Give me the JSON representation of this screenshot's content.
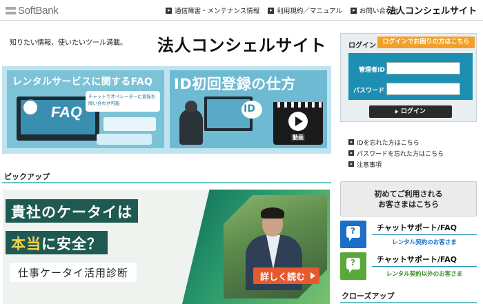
{
  "header": {
    "logo_text": "SoftBank",
    "links": [
      {
        "label": "通信障害・メンテナンス情報"
      },
      {
        "label": "利用規約／マニュアル"
      },
      {
        "label": "お問い合わせ"
      }
    ],
    "site_name": "法人コンシェルサイト"
  },
  "intro": {
    "tagline": "知りたい情報、使いたいツール満載。",
    "title": "法人コンシェルサイト"
  },
  "banners": {
    "faq": {
      "title": "レンタルサービスに関するFAQ",
      "bubble_text": "チャットでオペレーターに直接お問い合わせ可能",
      "screen_word": "FAQ"
    },
    "id": {
      "title": "ID初回登録の仕方",
      "bubble_text": "ID",
      "video_label": "動画"
    }
  },
  "pickup": {
    "section_label": "ピックアップ",
    "banner": {
      "line1": "貴社のケータイは",
      "line2_highlight": "本当",
      "line2_rest": "に安全？",
      "line3": "仕事ケータイ活用診断",
      "cta": "詳しく読む"
    }
  },
  "login": {
    "label": "ログイン",
    "help_button": "ログインでお困りの方はこちら",
    "admin_id_label": "管理者ID",
    "password_label": "パスワード",
    "admin_id_value": "",
    "password_value": "",
    "submit": "ログイン"
  },
  "side_links": [
    {
      "label": "IDを忘れた方はこちら"
    },
    {
      "label": "パスワードを忘れた方はこちら"
    },
    {
      "label": "注意事項"
    }
  ],
  "first_time": {
    "line1": "初めてご利用される",
    "line2": "お客さまはこちら"
  },
  "chat_support": [
    {
      "title": "チャットサポート/FAQ",
      "subtitle": "レンタル契約のお客さま",
      "color": "#1c6fc7",
      "sub_color": "#1c6fc7"
    },
    {
      "title": "チャットサポート/FAQ",
      "subtitle": "レンタル契約以外のお客さま",
      "color": "#5aa83a",
      "sub_color": "#3c8f27"
    }
  ],
  "closeup": {
    "section_label": "クローズアップ"
  },
  "colors": {
    "accent_teal": "#6cc0c6",
    "login_blue": "#1c8fb3",
    "help_orange": "#f2a02a",
    "cta_orange": "#e65a2e"
  }
}
